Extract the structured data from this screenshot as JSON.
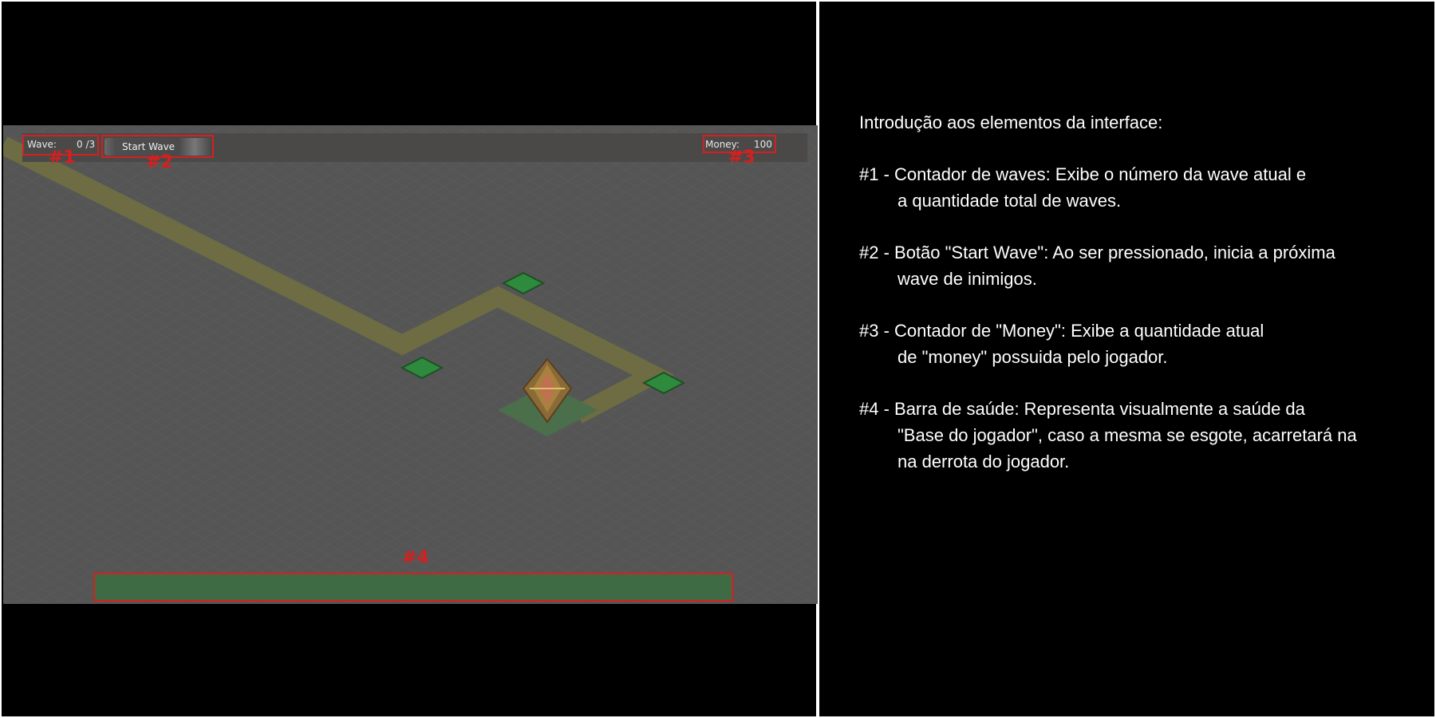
{
  "hud": {
    "wave_label": "Wave:",
    "wave_value": "0 /3",
    "start_wave_label": "Start Wave",
    "money_label": "Money:",
    "money_value": "100"
  },
  "callouts": {
    "c1": "#1",
    "c2": "#2",
    "c3": "#3",
    "c4": "#4"
  },
  "health": {
    "fraction": 1.0,
    "color": "#3f6b44"
  },
  "colors": {
    "ground": "#555555",
    "path": "#6e6c42",
    "tower_slot": "#2e8a3c",
    "base": "#4b6e4b",
    "callout_red": "#d42020"
  },
  "info": {
    "title": "Introdução aos elementos da interface:",
    "items": [
      {
        "line1": "#1 - Contador de waves: Exibe o número da wave atual e",
        "line2": "a quantidade total de waves."
      },
      {
        "line1": "#2 - Botão \"Start Wave\": Ao ser pressionado, inicia a próxima",
        "line2": "wave de inimigos."
      },
      {
        "line1": "#3 - Contador de \"Money\": Exibe a quantidade atual",
        "line2": "de \"money\" possuida pelo jogador."
      },
      {
        "line1": "#4 - Barra de saúde: Representa visualmente a saúde da",
        "line2": "\"Base do jogador\", caso a mesma se esgote, acarretará na",
        "line3": "na derrota do jogador."
      }
    ]
  }
}
